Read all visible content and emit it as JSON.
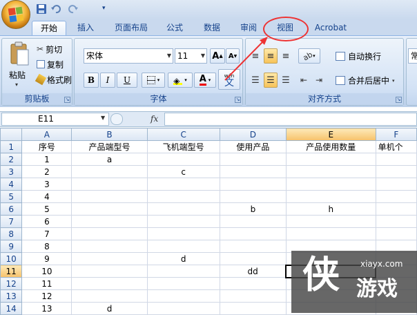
{
  "qat_icons": [
    "save-icon",
    "undo-icon",
    "redo-icon",
    "customize-qat-icon"
  ],
  "tabs": [
    {
      "label": "开始",
      "active": true
    },
    {
      "label": "插入"
    },
    {
      "label": "页面布局"
    },
    {
      "label": "公式"
    },
    {
      "label": "数据"
    },
    {
      "label": "审阅"
    },
    {
      "label": "视图"
    },
    {
      "label": "Acrobat"
    }
  ],
  "clipboard": {
    "group_label": "剪贴板",
    "paste_label": "粘贴",
    "cut_label": "剪切",
    "copy_label": "复制",
    "format_painter_label": "格式刷"
  },
  "font": {
    "group_label": "字体",
    "font_name": "宋体",
    "font_size": "11",
    "grow_label": "A",
    "shrink_label": "A",
    "bold": "B",
    "italic": "I",
    "underline": "U",
    "font_color_label": "A",
    "phonetic_label": "文",
    "phonetic_small": "wén"
  },
  "alignment": {
    "group_label": "对齐方式",
    "wrap_label": "自动换行",
    "merge_label": "合并后居中"
  },
  "number": {
    "format_partial": "常"
  },
  "formula_bar": {
    "cell_ref": "E11",
    "fx": "fx"
  },
  "grid": {
    "columns": [
      "A",
      "B",
      "C",
      "D",
      "E",
      "F"
    ],
    "selected_column": "E",
    "selected_row": 11,
    "rows": [
      {
        "n": 1,
        "cells": [
          "序号",
          "产品端型号",
          "飞机端型号",
          "使用产品",
          "产品使用数量",
          "单机个"
        ]
      },
      {
        "n": 2,
        "cells": [
          "1",
          "a",
          "",
          "",
          "",
          ""
        ]
      },
      {
        "n": 3,
        "cells": [
          "2",
          "",
          "c",
          "",
          "",
          ""
        ]
      },
      {
        "n": 4,
        "cells": [
          "3",
          "",
          "",
          "",
          "",
          ""
        ]
      },
      {
        "n": 5,
        "cells": [
          "4",
          "",
          "",
          "",
          "",
          ""
        ]
      },
      {
        "n": 6,
        "cells": [
          "5",
          "",
          "",
          "b",
          "h",
          ""
        ]
      },
      {
        "n": 7,
        "cells": [
          "6",
          "",
          "",
          "",
          "",
          ""
        ]
      },
      {
        "n": 8,
        "cells": [
          "7",
          "",
          "",
          "",
          "",
          ""
        ]
      },
      {
        "n": 9,
        "cells": [
          "8",
          "",
          "",
          "",
          "",
          ""
        ]
      },
      {
        "n": 10,
        "cells": [
          "9",
          "",
          "d",
          "",
          "",
          ""
        ]
      },
      {
        "n": 11,
        "cells": [
          "10",
          "",
          "",
          "dd",
          "",
          ""
        ]
      },
      {
        "n": 12,
        "cells": [
          "11",
          "",
          "",
          "",
          "",
          ""
        ]
      },
      {
        "n": 13,
        "cells": [
          "12",
          "",
          "",
          "",
          "",
          ""
        ]
      },
      {
        "n": 14,
        "cells": [
          "13",
          "d",
          "",
          "",
          "",
          ""
        ]
      }
    ]
  },
  "watermark": {
    "logo_char": "侠",
    "site": "xiayx.com",
    "brand": "游戏"
  },
  "colors": {
    "callout": "#e33333",
    "accent": "#15428b",
    "selected_header": "#f7c26a"
  }
}
